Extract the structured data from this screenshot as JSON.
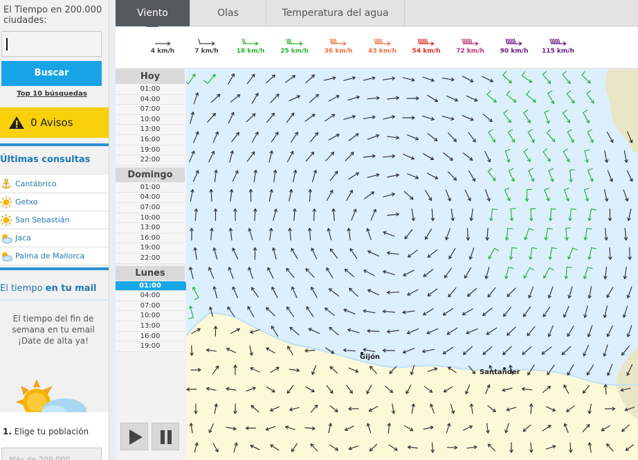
{
  "sidebar": {
    "search_title": "El Tiempo en 200.000 ciudades:",
    "search_value": "",
    "search_button": "Buscar",
    "top10_link": "Top 10 búsquedas",
    "avisos": "0 Avisos",
    "recent_title": "Últimas consultas",
    "recent": [
      {
        "label": "Cantábrico",
        "icon": "anchor-icon"
      },
      {
        "label": "Getxo",
        "icon": "sun-icon"
      },
      {
        "label": "San Sebastián",
        "icon": "sun-icon"
      },
      {
        "label": "Jaca",
        "icon": "cloud-sun-icon"
      },
      {
        "label": "Palma de Mallorca",
        "icon": "cloud-sun-icon"
      }
    ],
    "mail_title_prefix": "El tiempo ",
    "mail_title_highlight": "en tu mail",
    "mail_text": "El tiempo del fin de semana en tu email ¡Date de alta ya!",
    "step_number": "1.",
    "step_label": "Elige tu población",
    "step_placeholder": "Más de 200.000"
  },
  "tabs": [
    {
      "label": "Viento",
      "active": true
    },
    {
      "label": "Olas",
      "active": false
    },
    {
      "label": "Temperatura del agua",
      "active": false
    }
  ],
  "legend": [
    {
      "label": "4 km/h",
      "color": "#444444"
    },
    {
      "label": "7 km/h",
      "color": "#444444"
    },
    {
      "label": "18 km/h",
      "color": "#2db52d"
    },
    {
      "label": "25 km/h",
      "color": "#2db52d"
    },
    {
      "label": "36 km/h",
      "color": "#f07040"
    },
    {
      "label": "43 km/h",
      "color": "#f07040"
    },
    {
      "label": "54 km/h",
      "color": "#e0302a"
    },
    {
      "label": "72 km/h",
      "color": "#c0307a"
    },
    {
      "label": "90 km/h",
      "color": "#6a1a8a"
    },
    {
      "label": "115 km/h",
      "color": "#6a1a8a"
    }
  ],
  "schedule": [
    {
      "day": "Hoy",
      "hours": [
        "01:00",
        "04:00",
        "07:00",
        "10:00",
        "13:00",
        "16:00",
        "19:00",
        "22:00"
      ]
    },
    {
      "day": "Domingo",
      "hours": [
        "01:00",
        "04:00",
        "07:00",
        "10:00",
        "13:00",
        "16:00",
        "19:00",
        "22:00"
      ]
    },
    {
      "day": "Lunes",
      "hours": [
        "01:00",
        "04:00",
        "07:00",
        "10:00",
        "13:00",
        "16:00",
        "19:00"
      ]
    }
  ],
  "selected_time": {
    "day": "Lunes",
    "hour": "01:00"
  },
  "map": {
    "cities": [
      "Gijón",
      "Santander"
    ],
    "colors": {
      "sea": "#dcefff",
      "land": "#fbf9d8",
      "land_east": "#e9e6c7",
      "coast": "#bfe0f7",
      "arrow": "#333333"
    }
  }
}
